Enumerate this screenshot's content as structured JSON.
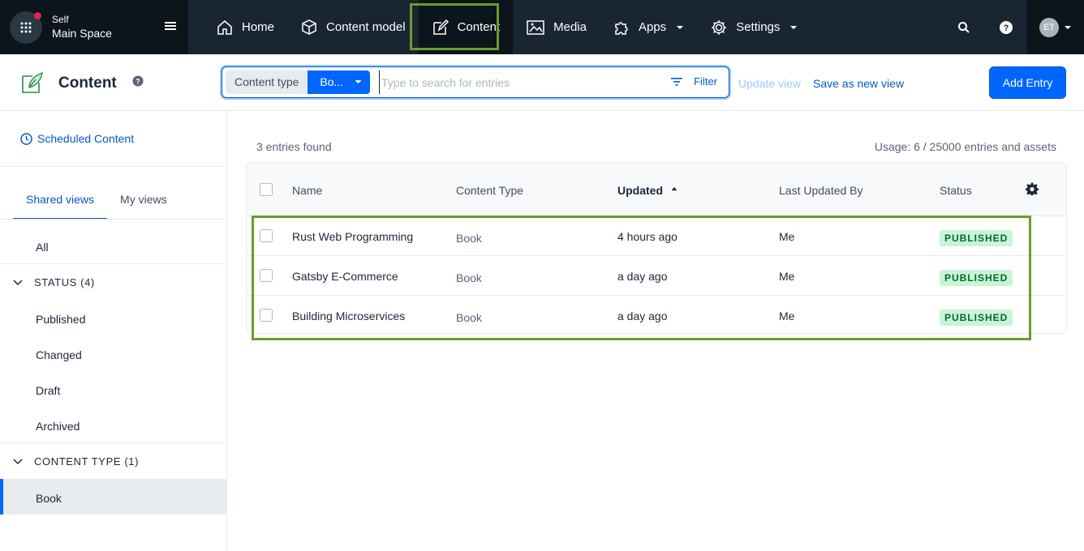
{
  "space": {
    "org": "Self",
    "name": "Main Space"
  },
  "nav": {
    "home": "Home",
    "content_model": "Content model",
    "content": "Content",
    "media": "Media",
    "apps": "Apps",
    "settings": "Settings"
  },
  "account": {
    "initials": "ET"
  },
  "header": {
    "title": "Content",
    "content_type_label": "Content type",
    "content_type_value": "Bo...",
    "search_placeholder": "Type to search for entries",
    "filter_label": "Filter",
    "update_view": "Update view",
    "save_view": "Save as new view",
    "add_entry": "Add Entry"
  },
  "sidebar": {
    "scheduled": "Scheduled Content",
    "tabs": [
      "Shared views",
      "My views"
    ],
    "all": "All",
    "status_group": "STATUS (4)",
    "status_items": [
      "Published",
      "Changed",
      "Draft",
      "Archived"
    ],
    "content_type_group": "CONTENT TYPE (1)",
    "content_type_items": [
      "Book"
    ]
  },
  "main": {
    "entries_found": "3 entries found",
    "usage": "Usage: 6 / 25000 entries and assets",
    "columns": [
      "Name",
      "Content Type",
      "Updated",
      "Last Updated By",
      "Status"
    ],
    "rows": [
      {
        "name": "Rust Web Programming",
        "type": "Book",
        "updated": "4 hours ago",
        "by": "Me",
        "status": "PUBLISHED"
      },
      {
        "name": "Gatsby E-Commerce",
        "type": "Book",
        "updated": "a day ago",
        "by": "Me",
        "status": "PUBLISHED"
      },
      {
        "name": "Building Microservices",
        "type": "Book",
        "updated": "a day ago",
        "by": "Me",
        "status": "PUBLISHED"
      }
    ]
  },
  "colors": {
    "primary": "#0066ff",
    "nav_bg": "#192532",
    "highlight": "#6a9c2c",
    "published_bg": "#c9f5d5"
  }
}
